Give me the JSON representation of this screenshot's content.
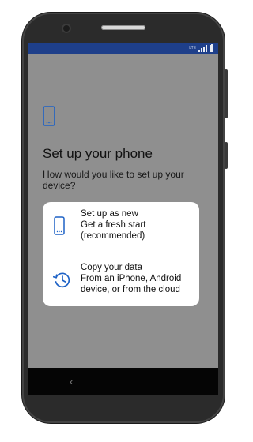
{
  "status": {
    "carrier_text": "LTE",
    "signal": "signal-icon",
    "battery": "battery-icon"
  },
  "setup": {
    "title": "Set up your phone",
    "question": "How would you like to set up your device?"
  },
  "options": [
    {
      "icon": "phone-icon",
      "title": "Set up as new",
      "line1": "Get a fresh start",
      "line2": "(recommended)"
    },
    {
      "icon": "restore-clock-icon",
      "title": "Copy your data",
      "line1": "From an iPhone, Android",
      "line2": "device, or from the cloud"
    }
  ],
  "nav": {
    "back_glyph": "‹"
  },
  "colors": {
    "accent": "#1e62c6",
    "statusbar": "#1e3f8a",
    "screen_dim": "#8f8f8f"
  }
}
